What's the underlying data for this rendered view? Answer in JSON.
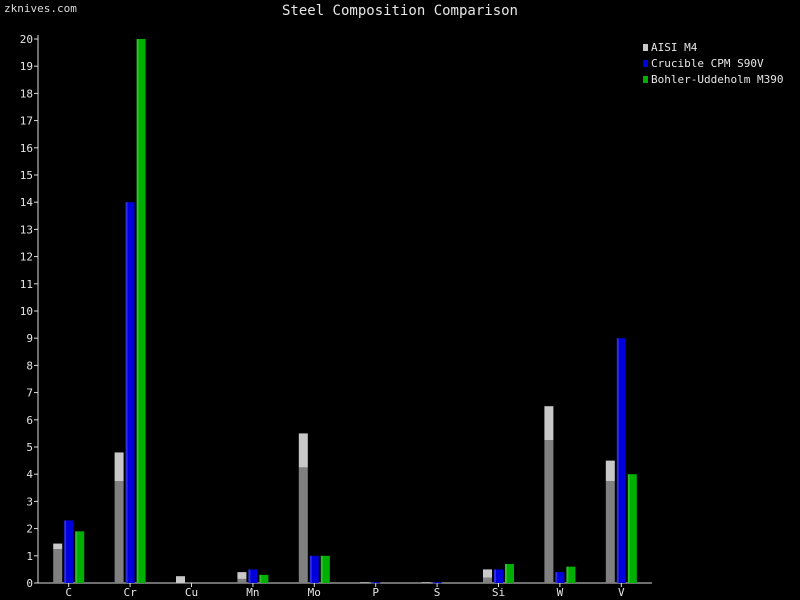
{
  "watermark": "zknives.com",
  "chart_data": {
    "type": "bar",
    "title": "Steel Composition Comparison",
    "xlabel": "",
    "ylabel": "",
    "categories": [
      "C",
      "Cr",
      "Cu",
      "Mn",
      "Mo",
      "P",
      "S",
      "Si",
      "W",
      "V"
    ],
    "ylim": [
      0,
      20
    ],
    "yticks": [
      0,
      1,
      2,
      3,
      4,
      5,
      6,
      7,
      8,
      9,
      10,
      11,
      12,
      13,
      14,
      15,
      16,
      17,
      18,
      19,
      20
    ],
    "grid": false,
    "legend_position": "top-right",
    "series": [
      {
        "name": "AISI M4",
        "color": "#808080",
        "highlight": "#c8c8c8",
        "values": [
          1.45,
          4.8,
          0.25,
          0.4,
          5.5,
          0.03,
          0.03,
          0.5,
          6.5,
          4.5
        ],
        "ranges": [
          [
            1.25,
            1.45
          ],
          [
            3.75,
            4.8
          ],
          [
            0,
            0.25
          ],
          [
            0.15,
            0.4
          ],
          [
            4.25,
            5.5
          ],
          [
            0,
            0.03
          ],
          [
            0,
            0.03
          ],
          [
            0.2,
            0.5
          ],
          [
            5.25,
            6.5
          ],
          [
            3.75,
            4.5
          ]
        ]
      },
      {
        "name": "Crucible CPM S90V",
        "color": "#0000dd",
        "highlight": "#0000dd",
        "values": [
          2.3,
          14.0,
          0,
          0.5,
          1.0,
          0.03,
          0.03,
          0.5,
          0.4,
          9.0
        ]
      },
      {
        "name": "Bohler-Uddeholm M390",
        "color": "#00b000",
        "highlight": "#00b000",
        "values": [
          1.9,
          20.0,
          0,
          0.3,
          1.0,
          0,
          0,
          0.7,
          0.6,
          4.0
        ]
      }
    ]
  }
}
